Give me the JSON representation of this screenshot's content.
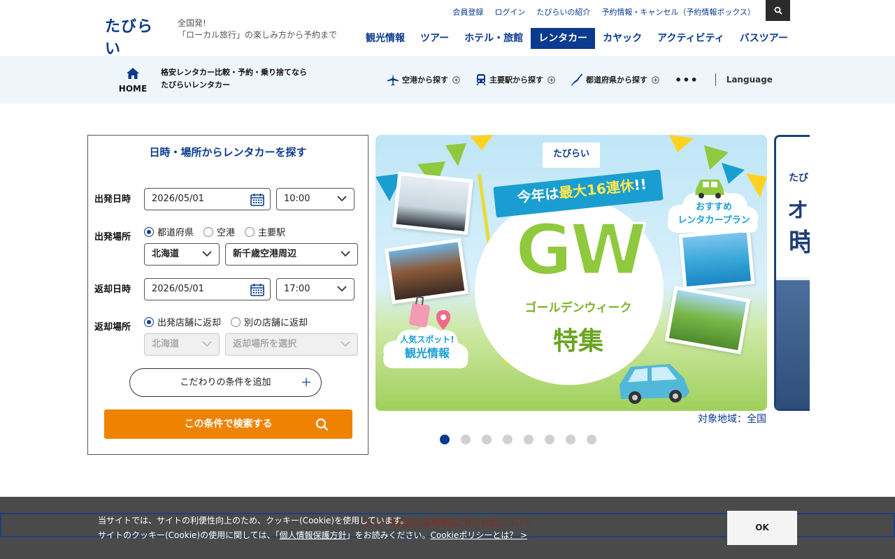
{
  "header": {
    "logo_text": "たびらい",
    "tagline_line1": "全国発!",
    "tagline_line2": "「ローカル旅行」の楽しみ方から予約まで",
    "top_links": [
      "会員登録",
      "ログイン",
      "たびらいの紹介",
      "予約情報・キャンセル（予約情報ボックス）"
    ],
    "nav": [
      {
        "label": "観光情報",
        "active": false
      },
      {
        "label": "ツアー",
        "active": false
      },
      {
        "label": "ホテル・旅館",
        "active": false
      },
      {
        "label": "レンタカー",
        "active": true
      },
      {
        "label": "カヤック",
        "active": false
      },
      {
        "label": "アクティビティ",
        "active": false
      },
      {
        "label": "バスツアー",
        "active": false
      }
    ]
  },
  "subbar": {
    "home_label": "HOME",
    "title_line1": "格安レンタカー比較・予約・乗り捨てなら",
    "title_line2": "たびらいレンタカー",
    "links": [
      "空港から探す",
      "主要駅から探す",
      "都道府県から探す"
    ],
    "more": "•••",
    "language": "Language"
  },
  "search_panel": {
    "title": "日時・場所からレンタカーを探す",
    "depart_date_label": "出発日時",
    "depart_date": "2026/05/01",
    "depart_time": "10:00",
    "depart_place_label": "出発場所",
    "depart_place_options": [
      "都道府県",
      "空港",
      "主要駅"
    ],
    "depart_prefecture": "北海道",
    "depart_area": "新千歳空港周辺",
    "return_date_label": "返却日時",
    "return_date": "2026/05/01",
    "return_time": "17:00",
    "return_place_label": "返却場所",
    "return_place_options": [
      "出発店舗に返却",
      "別の店舗に返却"
    ],
    "return_prefecture": "北海道",
    "return_area_placeholder": "返却場所を選択",
    "add_condition": "こだわりの条件を追加",
    "search_button": "この条件で検索する"
  },
  "banner": {
    "brand": "たびらい",
    "ribbon_prefix": "今年は",
    "ribbon_highlight": "最大16連休",
    "ribbon_suffix": "!!",
    "gw": "GW",
    "golden_week": "ゴールデンウィーク",
    "tokushu": "特集",
    "recommend_line1": "おすすめ",
    "recommend_line2": "レンタカープラン",
    "spot_line1": "人気スポット!",
    "spot_line2": "観光情報",
    "region": "対象地域：全国",
    "slide_count": 8,
    "active_slide": 1
  },
  "banner2": {
    "text1": "たび",
    "text2": "オ",
    "text3": "時"
  },
  "cookie": {
    "notice": "ネット免許証の運用開始に伴う対応について",
    "line1": "当サイトでは、サイトの利便性向上のため、クッキー(Cookie)を使用しています。",
    "line2_prefix": "サイトのクッキー(Cookie)の使用に関しては、「",
    "line2_link": "個人情報保護方針",
    "line2_suffix": "」をお読みください。",
    "policy_link": "Cookieポリシーとは？ >",
    "ok": "OK"
  },
  "colors": {
    "brand_navy": "#0b3a8e",
    "search_orange": "#ef8200",
    "subbar_bg": "#eef6fb"
  }
}
